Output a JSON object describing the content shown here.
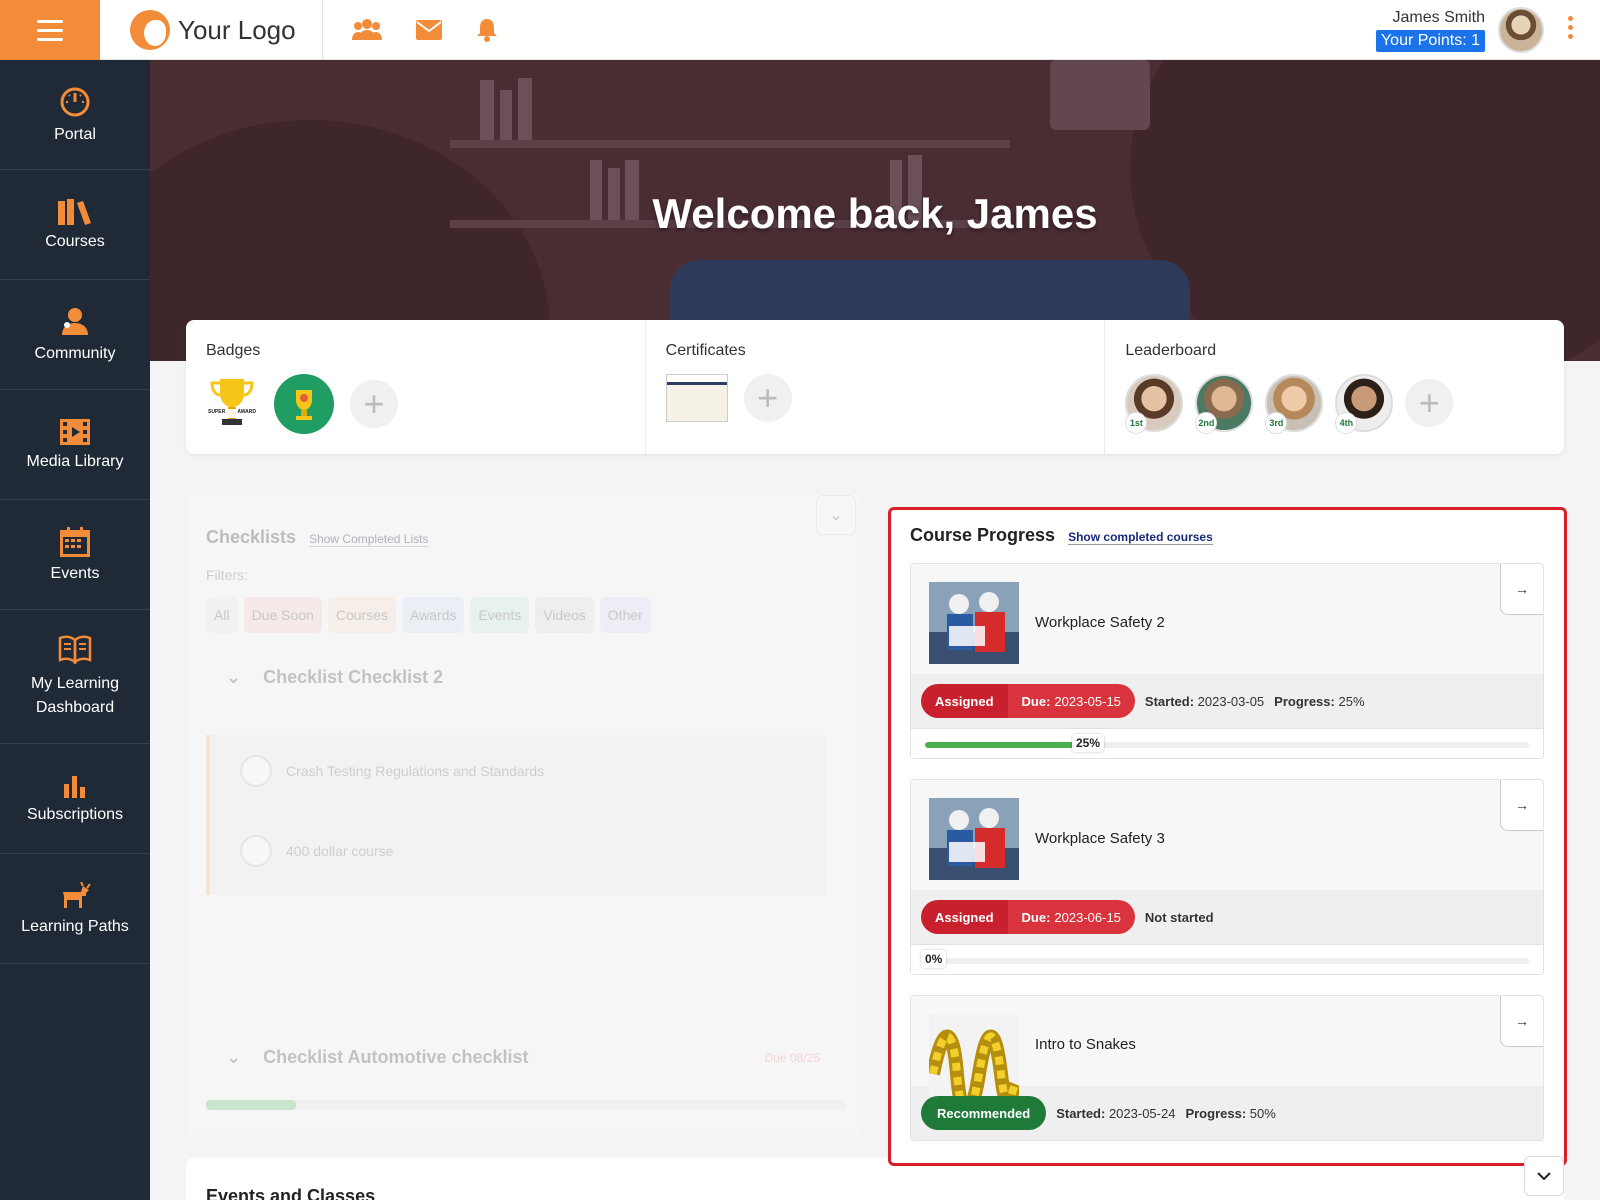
{
  "topbar": {
    "logo_text": "Your Logo",
    "user_name": "James Smith",
    "points_label": "Your Points: 1"
  },
  "sidebar": {
    "items": [
      {
        "label": "Portal",
        "icon": "gauge-icon"
      },
      {
        "label": "Courses",
        "icon": "books-icon"
      },
      {
        "label": "Community",
        "icon": "people-icon"
      },
      {
        "label": "Media Library",
        "icon": "film-icon"
      },
      {
        "label": "Events",
        "icon": "calendar-icon"
      },
      {
        "label": "My Learning Dashboard",
        "icon": "open-book-icon"
      },
      {
        "label": "Subscriptions",
        "icon": "bar-chart-icon"
      },
      {
        "label": "Learning Paths",
        "icon": "goat-icon"
      }
    ]
  },
  "hero": {
    "title": "Welcome back, James"
  },
  "cards": {
    "badges_title": "Badges",
    "badge_text_top": "SUPER",
    "badge_text_bottom": "AWARD",
    "certificates_title": "Certificates",
    "leaderboard_title": "Leaderboard",
    "ranks": [
      "1st",
      "2nd",
      "3rd",
      "4th"
    ]
  },
  "checklists": {
    "title": "Checklists",
    "show_completed": "Show Completed Lists",
    "filters_label": "Filters:",
    "filters": [
      "All",
      "Due Soon",
      "Courses",
      "Awards",
      "Events",
      "Videos",
      "Other"
    ],
    "section1": "Checklist Checklist 2",
    "items": [
      "Crash Testing Regulations and Standards",
      "400 dollar course"
    ],
    "section2": "Checklist Automotive checklist",
    "due": "Due 08/25"
  },
  "course_progress": {
    "title": "Course Progress",
    "show_completed": "Show completed courses",
    "courses": [
      {
        "name": "Workplace Safety 2",
        "status": "Assigned",
        "due_label": "Due:",
        "due": "2023-05-15",
        "started_label": "Started:",
        "started": "2023-03-05",
        "progress_label": "Progress:",
        "progress_text": "25%",
        "progress": 25,
        "bar_label": "25%"
      },
      {
        "name": "Workplace Safety 3",
        "status": "Assigned",
        "due_label": "Due:",
        "due": "2023-06-15",
        "not_started": "Not started",
        "progress": 0,
        "bar_label": "0%"
      },
      {
        "name": "Intro to Snakes",
        "status": "Recommended",
        "started_label": "Started:",
        "started": "2023-05-24",
        "progress_label": "Progress:",
        "progress_text": "50%",
        "progress": 50
      }
    ]
  },
  "events": {
    "title": "Events and Classes"
  },
  "colors": {
    "accent": "#f28c38",
    "sidebar_bg": "#1f2a36",
    "assigned": "#c8202c",
    "recommended": "#1f7a3a",
    "highlight": "#d9202a",
    "points_bg": "#1a73e8"
  }
}
